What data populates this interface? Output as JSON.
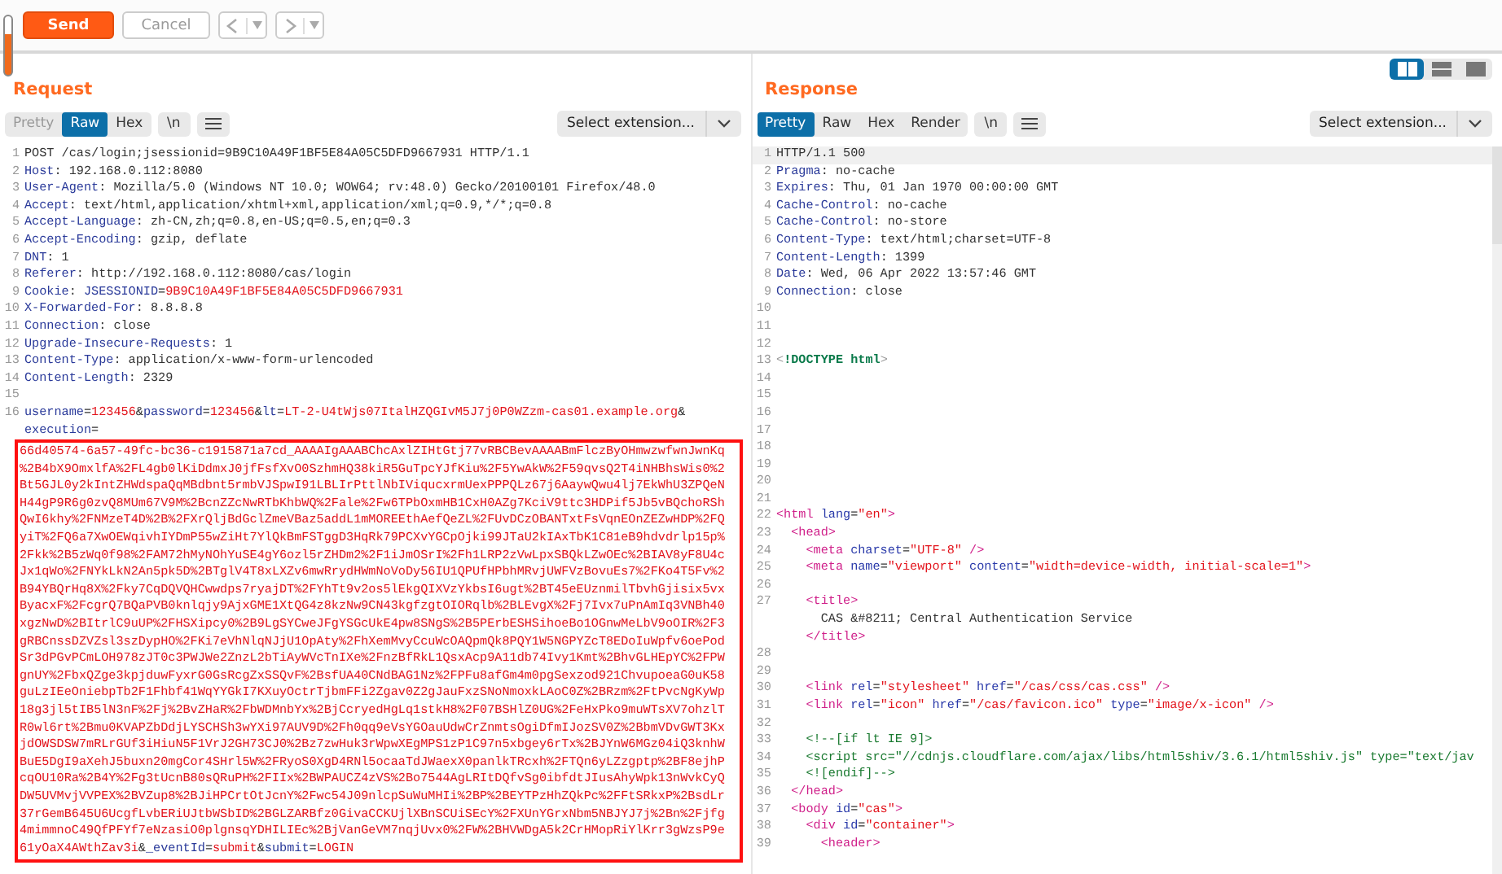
{
  "toolbar": {
    "buttons": [
      {
        "label": "Send",
        "kind": "primary"
      },
      {
        "label": "Cancel",
        "kind": "secondary"
      }
    ],
    "nav": [
      {
        "kind": "back",
        "disabled": true
      },
      {
        "kind": "forward",
        "disabled": true
      }
    ]
  },
  "layout_toggle": [
    {
      "kind": "columns",
      "selected": true
    },
    {
      "kind": "rows",
      "selected": false
    },
    {
      "kind": "single",
      "selected": false
    }
  ],
  "request": {
    "title": "Request",
    "tabs": [
      {
        "label": "Pretty",
        "selected": false,
        "disabled": true
      },
      {
        "label": "Raw",
        "selected": true,
        "disabled": false
      },
      {
        "label": "Hex",
        "selected": false,
        "disabled": false
      }
    ],
    "newline_button": "\\n",
    "extension_select": "Select extension...",
    "lines": [
      {
        "number": "1",
        "wraps": [
          {
            "spans": [
              {
                "text": "POST /cas/login;jsessionid=9B9C10A49F1BF5E84A05C5DFD9667931 HTTP/1.1",
                "kind": "plain"
              }
            ]
          }
        ]
      },
      {
        "number": "2",
        "wraps": [
          {
            "spans": [
              {
                "text": "Host",
                "kind": "name"
              },
              {
                "text": ": 192.168.0.112:8080",
                "kind": "plain"
              }
            ]
          }
        ]
      },
      {
        "number": "3",
        "wraps": [
          {
            "spans": [
              {
                "text": "User-Agent",
                "kind": "name"
              },
              {
                "text": ": Mozilla/5.0 (Windows NT 10.0; WOW64; rv:48.0) Gecko/20100101 Firefox/48.0",
                "kind": "plain"
              }
            ]
          }
        ]
      },
      {
        "number": "4",
        "wraps": [
          {
            "spans": [
              {
                "text": "Accept",
                "kind": "name"
              },
              {
                "text": ": text/html,application/xhtml+xml,application/xml;q=0.9,*/*;q=0.8",
                "kind": "plain"
              }
            ]
          }
        ]
      },
      {
        "number": "5",
        "wraps": [
          {
            "spans": [
              {
                "text": "Accept-Language",
                "kind": "name"
              },
              {
                "text": ": zh-CN,zh;q=0.8,en-US;q=0.5,en;q=0.3",
                "kind": "plain"
              }
            ]
          }
        ]
      },
      {
        "number": "6",
        "wraps": [
          {
            "spans": [
              {
                "text": "Accept-Encoding",
                "kind": "name"
              },
              {
                "text": ": gzip, deflate",
                "kind": "plain"
              }
            ]
          }
        ]
      },
      {
        "number": "7",
        "wraps": [
          {
            "spans": [
              {
                "text": "DNT",
                "kind": "name"
              },
              {
                "text": ": 1",
                "kind": "plain"
              }
            ]
          }
        ]
      },
      {
        "number": "8",
        "wraps": [
          {
            "spans": [
              {
                "text": "Referer",
                "kind": "name"
              },
              {
                "text": ": http://192.168.0.112:8080/cas/login",
                "kind": "plain"
              }
            ]
          }
        ]
      },
      {
        "number": "9",
        "wraps": [
          {
            "spans": [
              {
                "text": "Cookie",
                "kind": "name"
              },
              {
                "text": ": ",
                "kind": "plain"
              },
              {
                "text": "JSESSIONID",
                "kind": "name"
              },
              {
                "text": "=",
                "kind": "plain"
              },
              {
                "text": "9B9C10A49F1BF5E84A05C5DFD9667931",
                "kind": "value"
              }
            ]
          }
        ]
      },
      {
        "number": "10",
        "wraps": [
          {
            "spans": [
              {
                "text": "X-Forwarded-For",
                "kind": "name"
              },
              {
                "text": ": 8.8.8.8",
                "kind": "plain"
              }
            ]
          }
        ]
      },
      {
        "number": "11",
        "wraps": [
          {
            "spans": [
              {
                "text": "Connection",
                "kind": "name"
              },
              {
                "text": ": close",
                "kind": "plain"
              }
            ]
          }
        ]
      },
      {
        "number": "12",
        "wraps": [
          {
            "spans": [
              {
                "text": "Upgrade-Insecure-Requests",
                "kind": "name"
              },
              {
                "text": ": 1",
                "kind": "plain"
              }
            ]
          }
        ]
      },
      {
        "number": "13",
        "wraps": [
          {
            "spans": [
              {
                "text": "Content-Type",
                "kind": "name"
              },
              {
                "text": ": application/x-www-form-urlencoded",
                "kind": "plain"
              }
            ]
          }
        ]
      },
      {
        "number": "14",
        "wraps": [
          {
            "spans": [
              {
                "text": "Content-Length",
                "kind": "name"
              },
              {
                "text": ": 2329",
                "kind": "plain"
              }
            ]
          }
        ]
      },
      {
        "number": "15"
      },
      {
        "number": "16",
        "wraps": [
          {
            "spans": [
              {
                "text": "username",
                "kind": "name"
              },
              {
                "text": "=",
                "kind": "plain"
              },
              {
                "text": "123456",
                "kind": "value"
              },
              {
                "text": "&",
                "kind": "plain"
              },
              {
                "text": "password",
                "kind": "name"
              },
              {
                "text": "=",
                "kind": "plain"
              },
              {
                "text": "123456",
                "kind": "value"
              },
              {
                "text": "&",
                "kind": "plain"
              },
              {
                "text": "lt",
                "kind": "name"
              },
              {
                "text": "=",
                "kind": "plain"
              },
              {
                "text": "LT-2-U4tWjs07ItalHZQGIvM5J7j0P0WZzm-cas01.example.org",
                "kind": "value"
              },
              {
                "text": "&",
                "kind": "plain"
              }
            ]
          },
          {
            "spans": [
              {
                "text": "execution",
                "kind": "name"
              },
              {
                "text": "=",
                "kind": "plain"
              }
            ]
          }
        ],
        "boxed_wraps": [
          {
            "spans": [
              {
                "text": "66d40574-6a57-49fc-bc36-c1915871a7cd_AAAAIgAAABChcAxlZIHtGtj77vRBCBevAAAABmFlczByOHmwzwfwnJwnKq",
                "kind": "value"
              }
            ]
          },
          {
            "spans": [
              {
                "text": "%2B4bX9OmxlfA%2FL4gb0lKiDdmxJ0jfFsfXvO0SzhmHQ38kiR5GuTpcYJfKiu%2F5YwAkW%2F59qvsQ2T4iNHBhsWis0%2",
                "kind": "value"
              }
            ]
          },
          {
            "spans": [
              {
                "text": "Bt5GJL0y2kIntZHWdspaQqMBdbnt5rmbVJSpwI91LBLIrPttlNbIViqucxrmUexPPPQLz67j6AaywQwu4lj7EkWhU3ZPQeN",
                "kind": "value"
              }
            ]
          },
          {
            "spans": [
              {
                "text": "H44gP9R6g0zvQ8MUm67V9M%2BcnZZcNwRTbKhbWQ%2Fale%2Fw6TPbOxmHB1CxH0AZg7KciV9ttc3HDPif5Jb5vBQchoRSh",
                "kind": "value"
              }
            ]
          },
          {
            "spans": [
              {
                "text": "QwI6khy%2FNMzeT4D%2B%2FXrQljBdGclZmeVBaz5addL1mMOREEthAefQeZL%2FUvDCzOBANTxtFsVqnEOnZEZwHDP%2FQ",
                "kind": "value"
              }
            ]
          },
          {
            "spans": [
              {
                "text": "yiT%2FQ6a7XwOEWqivhIYDmP55wZiHt7YlQkBmFSTggD3HqRk79PCXvYGCpOjki99JTaU2kIAxTbK1C81eB9hdvdrlp15p%",
                "kind": "value"
              }
            ]
          },
          {
            "spans": [
              {
                "text": "2Fkk%2B5zWq0f98%2FAM72hMyNOhYuSE4gY6ozl5rZHDm2%2F1iJmOSrI%2Fh1LRP2zVwLpxSBQkLZwOEc%2BIAV8yF8U4c",
                "kind": "value"
              }
            ]
          },
          {
            "spans": [
              {
                "text": "Jx1qWo%2FNYkLkN2An5pk5D%2BTglV4T8xLXZv6mwRrydHWmNoVoDy56IU1QPUfHPbhMRvjUWFVzBovuEs7%2FKo4T5Fv%2",
                "kind": "value"
              }
            ]
          },
          {
            "spans": [
              {
                "text": "B94YBQrHq8X%2Fky7CqDQVQHCwwdps7ryajDT%2FYhTt9v2os5lEkgQIXVzYkbsI6ugt%2BT45eEUznmilTbvhGjisix5vx",
                "kind": "value"
              }
            ]
          },
          {
            "spans": [
              {
                "text": "ByacxF%2FcgrQ7BQaPVB0knlqjy9AjxGME1XtQG4z8kzNw9CN43kgfzgtOIORqlb%2BLEvgX%2Fj7Ivx7uPnAmIq3VNBh40",
                "kind": "value"
              }
            ]
          },
          {
            "spans": [
              {
                "text": "xgzNwD%2BItrlC9uUP%2FHSXipcy0%2B9LgSYCweJFgYSGcUkE4pw8SNgS%2B5PErbESHSihoeBo1OGnwMeLbV9oOIR%2F3",
                "kind": "value"
              }
            ]
          },
          {
            "spans": [
              {
                "text": "gRBCnssDZVZsl3szDypHO%2FKi7eVhNlqNJjU1OpAty%2FhXemMvyCcuWcOAQpmQk8PQY1W5NGPYZcT8EDoIuWpfv6oePod",
                "kind": "value"
              }
            ]
          },
          {
            "spans": [
              {
                "text": "Sr3dPGvPCmLOH978zJT0c3PWJWe2ZnzL2bTiAyWVcTnIXe%2FnzBfRkL1QsxAcp9A11db74Ivy1Kmt%2BhvGLHEpYC%2FPW",
                "kind": "value"
              }
            ]
          },
          {
            "spans": [
              {
                "text": "gnUY%2FbxQZge3kpjduwFyxrG0GsRcgZxSSQvF%2BsfUA40CNdBAG1Nz%2FPFu8afGm4m0pgSexzod921ChvupoeaG0uK58",
                "kind": "value"
              }
            ]
          },
          {
            "spans": [
              {
                "text": "guLzIEeOniebpTb2F1Fhbf41WqYYGkI7KXuyOctrTjbmFFi2Zgav0Z2gJauFxzSNoNmoxkLAoC0Z%2BRzm%2FtPvcNgKyWp",
                "kind": "value"
              }
            ]
          },
          {
            "spans": [
              {
                "text": "18g3jl5tIB5lN3nF%2Fj%2BvZHaR%2FbWDMnbYx%2BjCcryedHgLq1stkH8%2F07BSHlZ0UG%2FeHxPko9muWTsXV7ohzlT",
                "kind": "value"
              }
            ]
          },
          {
            "spans": [
              {
                "text": "R0wl6rt%2Bmu0KVAPZbDdjLYSCHSh3wYXi97AUV9D%2Fh0qq9eVsYGOauUdwCrZnmtsOgiDfmIJozSV0Z%2BbmVDvGWT3Kx",
                "kind": "value"
              }
            ]
          },
          {
            "spans": [
              {
                "text": "jdOWSDSW7mRLrGUf3iHiuN5F1VrJ2GH73CJ0%2Bz7zwHuk3rWpwXEgMPS1zP1C97n5xbgey6rTx%2BJYnW6MGz04iQ3knhW",
                "kind": "value"
              }
            ]
          },
          {
            "spans": [
              {
                "text": "BuE5DgI9aXehJ5buxn20mgCor4SHrl5W%2FRyoS0XgD4RNl5ocaaTdJWaexX0panlkTRcxh%2FTQn6yLZzgptp%2BF8ejhP",
                "kind": "value"
              }
            ]
          },
          {
            "spans": [
              {
                "text": "cqOU10Ra%2B4Y%2Fg3tUcnB80sQRuPH%2FIIx%2BWPAUCZ4zVS%2Bo7544AgLRItDQfvSg0ibfdtJIusAhyWpk13nWvkCyQ",
                "kind": "value"
              }
            ]
          },
          {
            "spans": [
              {
                "text": "DW5UVMvjVVPEX%2BVZup8%2BJiHPCrtOtJcnY%2Fwc54J09nlcpSuWuMHIi%2BP%2BEYTPzHhZQkPc%2FFtSRkxP%2BsdLr",
                "kind": "value"
              }
            ]
          },
          {
            "spans": [
              {
                "text": "37rGemB645U6UcgfLvbERiUJtbWSbID%2BGLZARBfz0GivaCCKUjlXBnSCUiSEcY%2FXUnYGrxNbm5NBJYJ7j%2Bn%2Fjfg",
                "kind": "value"
              }
            ]
          },
          {
            "spans": [
              {
                "text": "4mimmnoC49QfPFYf7eNzasiO0plgnsqYDHILIEc%2BjVanGeVM7nqjUvx0%2FW%2BHVWDgA5k2CrHMopRiYlKrr3gWzsP9e",
                "kind": "value"
              }
            ]
          },
          {
            "spans": [
              {
                "text": "61yOaX4AWthZav3i",
                "kind": "value"
              },
              {
                "text": "&",
                "kind": "plain"
              },
              {
                "text": "_eventId",
                "kind": "name"
              },
              {
                "text": "=",
                "kind": "plain"
              },
              {
                "text": "submit",
                "kind": "value"
              },
              {
                "text": "&",
                "kind": "plain"
              },
              {
                "text": "submit",
                "kind": "name"
              },
              {
                "text": "=",
                "kind": "plain"
              },
              {
                "text": "LOGIN",
                "kind": "value"
              }
            ]
          }
        ]
      }
    ]
  },
  "response": {
    "title": "Response",
    "tabs": [
      {
        "label": "Pretty",
        "selected": true,
        "disabled": false
      },
      {
        "label": "Raw",
        "selected": false,
        "disabled": false
      },
      {
        "label": "Hex",
        "selected": false,
        "disabled": false
      },
      {
        "label": "Render",
        "selected": false,
        "disabled": false
      }
    ],
    "newline_button": "\\n",
    "extension_select": "Select extension...",
    "lines": [
      {
        "number": "1",
        "current": true,
        "wraps": [
          {
            "spans": [
              {
                "text": "HTTP/1.1 500",
                "kind": "plain"
              }
            ]
          }
        ]
      },
      {
        "number": "2",
        "current": false,
        "wraps": [
          {
            "spans": [
              {
                "text": "Pragma",
                "kind": "name"
              },
              {
                "text": ": no-cache",
                "kind": "plain"
              }
            ]
          }
        ]
      },
      {
        "number": "3",
        "current": false,
        "wraps": [
          {
            "spans": [
              {
                "text": "Expires",
                "kind": "name"
              },
              {
                "text": ": Thu, 01 Jan 1970 00:00:00 GMT",
                "kind": "plain"
              }
            ]
          }
        ]
      },
      {
        "number": "4",
        "current": false,
        "wraps": [
          {
            "spans": [
              {
                "text": "Cache-Control",
                "kind": "name"
              },
              {
                "text": ": no-cache",
                "kind": "plain"
              }
            ]
          }
        ]
      },
      {
        "number": "5",
        "current": false,
        "wraps": [
          {
            "spans": [
              {
                "text": "Cache-Control",
                "kind": "name"
              },
              {
                "text": ": no-store",
                "kind": "plain"
              }
            ]
          }
        ]
      },
      {
        "number": "6",
        "current": false,
        "wraps": [
          {
            "spans": [
              {
                "text": "Content-Type",
                "kind": "name"
              },
              {
                "text": ": text/html;charset=UTF-8",
                "kind": "plain"
              }
            ]
          }
        ]
      },
      {
        "number": "7",
        "current": false,
        "wraps": [
          {
            "spans": [
              {
                "text": "Content-Length",
                "kind": "name"
              },
              {
                "text": ": 1399",
                "kind": "plain"
              }
            ]
          }
        ]
      },
      {
        "number": "8",
        "current": false,
        "wraps": [
          {
            "spans": [
              {
                "text": "Date",
                "kind": "name"
              },
              {
                "text": ": Wed, 06 Apr 2022 13:57:46 GMT",
                "kind": "plain"
              }
            ]
          }
        ]
      },
      {
        "number": "9",
        "current": false,
        "wraps": [
          {
            "spans": [
              {
                "text": "Connection",
                "kind": "name"
              },
              {
                "text": ": close",
                "kind": "plain"
              }
            ]
          }
        ]
      },
      {
        "number": "10",
        "current": false
      },
      {
        "number": "11",
        "current": false
      },
      {
        "number": "12",
        "current": false
      },
      {
        "number": "13",
        "current": false,
        "wraps": [
          {
            "spans": [
              {
                "text": "<",
                "kind": "punct"
              },
              {
                "text": "!DOCTYPE html",
                "kind": "doctype"
              },
              {
                "text": ">",
                "kind": "punct"
              }
            ]
          }
        ]
      },
      {
        "number": "14",
        "current": false
      },
      {
        "number": "15",
        "current": false
      },
      {
        "number": "16",
        "current": false
      },
      {
        "number": "17",
        "current": false
      },
      {
        "number": "18",
        "current": false
      },
      {
        "number": "19",
        "current": false
      },
      {
        "number": "20",
        "current": false
      },
      {
        "number": "21",
        "current": false
      },
      {
        "number": "22",
        "current": false,
        "wraps": [
          {
            "spans": [
              {
                "text": "<html",
                "kind": "tag"
              },
              {
                "text": " lang",
                "kind": "attr"
              },
              {
                "text": "=",
                "kind": "plain"
              },
              {
                "text": "\"en\"",
                "kind": "string"
              },
              {
                "text": ">",
                "kind": "tag"
              }
            ]
          }
        ]
      },
      {
        "number": "23",
        "current": false,
        "wraps": [
          {
            "spans": [
              {
                "text": "  <head>",
                "kind": "tag"
              }
            ]
          }
        ]
      },
      {
        "number": "24",
        "current": false,
        "wraps": [
          {
            "spans": [
              {
                "text": "    <meta",
                "kind": "tag"
              },
              {
                "text": " charset",
                "kind": "attr"
              },
              {
                "text": "=",
                "kind": "plain"
              },
              {
                "text": "\"UTF-8\"",
                "kind": "string"
              },
              {
                "text": " />",
                "kind": "tag"
              }
            ]
          }
        ]
      },
      {
        "number": "25",
        "current": false,
        "wraps": [
          {
            "spans": [
              {
                "text": "    <meta",
                "kind": "tag"
              },
              {
                "text": " name",
                "kind": "attr"
              },
              {
                "text": "=",
                "kind": "plain"
              },
              {
                "text": "\"viewport\"",
                "kind": "string"
              },
              {
                "text": " content",
                "kind": "attr"
              },
              {
                "text": "=",
                "kind": "plain"
              },
              {
                "text": "\"width=device-width, initial-scale=1\"",
                "kind": "string"
              },
              {
                "text": ">",
                "kind": "tag"
              }
            ]
          }
        ]
      },
      {
        "number": "26",
        "current": false
      },
      {
        "number": "27",
        "current": false,
        "wraps": [
          {
            "spans": [
              {
                "text": "    <title>",
                "kind": "tag"
              }
            ]
          },
          {
            "spans": [
              {
                "text": "      CAS &#8211; Central Authentication Service",
                "kind": "plain"
              }
            ]
          },
          {
            "spans": [
              {
                "text": "    </title>",
                "kind": "tag"
              }
            ]
          }
        ]
      },
      {
        "number": "28",
        "current": false
      },
      {
        "number": "29",
        "current": false
      },
      {
        "number": "30",
        "current": false,
        "wraps": [
          {
            "spans": [
              {
                "text": "    <link",
                "kind": "tag"
              },
              {
                "text": " rel",
                "kind": "attr"
              },
              {
                "text": "=",
                "kind": "plain"
              },
              {
                "text": "\"stylesheet\"",
                "kind": "string"
              },
              {
                "text": " href",
                "kind": "attr"
              },
              {
                "text": "=",
                "kind": "plain"
              },
              {
                "text": "\"/cas/css/cas.css\"",
                "kind": "string"
              },
              {
                "text": " />",
                "kind": "tag"
              }
            ]
          }
        ]
      },
      {
        "number": "31",
        "current": false,
        "wraps": [
          {
            "spans": [
              {
                "text": "    <link",
                "kind": "tag"
              },
              {
                "text": " rel",
                "kind": "attr"
              },
              {
                "text": "=",
                "kind": "plain"
              },
              {
                "text": "\"icon\"",
                "kind": "string"
              },
              {
                "text": " href",
                "kind": "attr"
              },
              {
                "text": "=",
                "kind": "plain"
              },
              {
                "text": "\"/cas/favicon.ico\"",
                "kind": "string"
              },
              {
                "text": " type",
                "kind": "attr"
              },
              {
                "text": "=",
                "kind": "plain"
              },
              {
                "text": "\"image/x-icon\"",
                "kind": "string"
              },
              {
                "text": " />",
                "kind": "tag"
              }
            ]
          }
        ]
      },
      {
        "number": "32",
        "current": false
      },
      {
        "number": "33",
        "current": false,
        "wraps": [
          {
            "spans": [
              {
                "text": "    <!--[if lt IE 9]>",
                "kind": "comment"
              }
            ]
          }
        ]
      },
      {
        "number": "34",
        "current": false,
        "wraps": [
          {
            "spans": [
              {
                "text": "    <script src=\"//cdnjs.cloudflare.com/ajax/libs/html5shiv/3.6.1/html5shiv.js\" type=\"text/jav",
                "kind": "comment"
              }
            ]
          }
        ]
      },
      {
        "number": "35",
        "current": false,
        "wraps": [
          {
            "spans": [
              {
                "text": "    <![endif]-->",
                "kind": "comment"
              }
            ]
          }
        ]
      },
      {
        "number": "36",
        "current": false,
        "wraps": [
          {
            "spans": [
              {
                "text": "  </head>",
                "kind": "tag"
              }
            ]
          }
        ]
      },
      {
        "number": "37",
        "current": false,
        "wraps": [
          {
            "spans": [
              {
                "text": "  <body",
                "kind": "tag"
              },
              {
                "text": " id",
                "kind": "attr"
              },
              {
                "text": "=",
                "kind": "plain"
              },
              {
                "text": "\"cas\"",
                "kind": "string"
              },
              {
                "text": ">",
                "kind": "tag"
              }
            ]
          }
        ]
      },
      {
        "number": "38",
        "current": false,
        "wraps": [
          {
            "spans": [
              {
                "text": "    <div",
                "kind": "tag"
              },
              {
                "text": " id",
                "kind": "attr"
              },
              {
                "text": "=",
                "kind": "plain"
              },
              {
                "text": "\"container\"",
                "kind": "string"
              },
              {
                "text": ">",
                "kind": "tag"
              }
            ]
          }
        ]
      },
      {
        "number": "39",
        "current": false,
        "wraps": [
          {
            "spans": [
              {
                "text": "      <header>",
                "kind": "tag"
              }
            ]
          }
        ]
      }
    ]
  }
}
